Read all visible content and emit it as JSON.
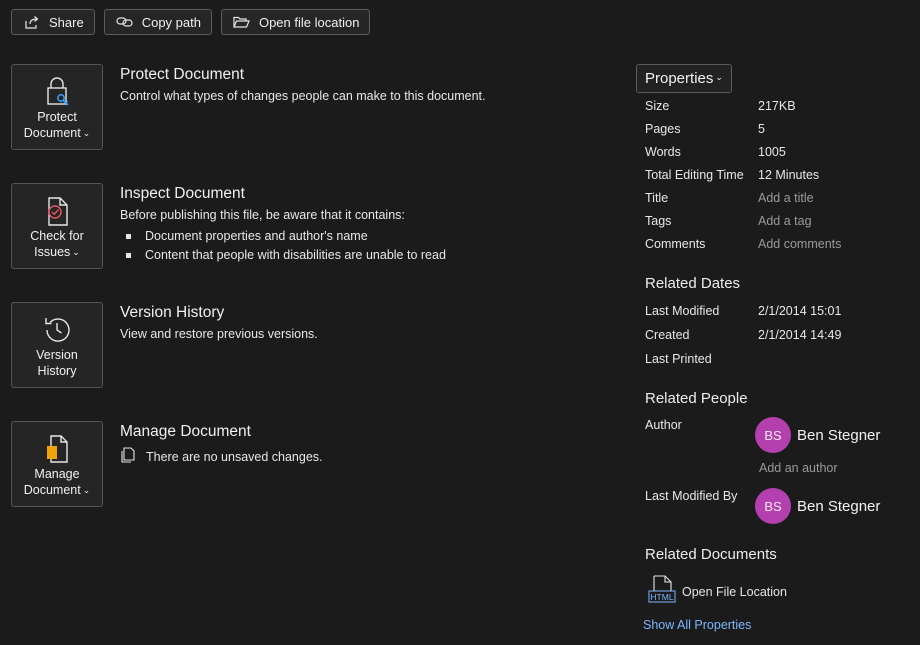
{
  "toolbar": {
    "share_label": "Share",
    "copy_path_label": "Copy path",
    "open_file_location_label": "Open file location"
  },
  "sections": {
    "protect": {
      "button_line1": "Protect",
      "button_line2": "Document",
      "title": "Protect Document",
      "description": "Control what types of changes people can make to this document."
    },
    "inspect": {
      "button_line1": "Check for",
      "button_line2": "Issues",
      "title": "Inspect Document",
      "description": "Before publishing this file, be aware that it contains:",
      "bullets": [
        "Document properties and author's name",
        "Content that people with disabilities are unable to read"
      ]
    },
    "version": {
      "button_line1": "Version",
      "button_line2": "History",
      "title": "Version History",
      "description": "View and restore previous versions."
    },
    "manage": {
      "button_line1": "Manage",
      "button_line2": "Document",
      "title": "Manage Document",
      "status": "There are no unsaved changes."
    }
  },
  "properties": {
    "header_label": "Properties",
    "rows": [
      {
        "key": "Size",
        "value": "217KB"
      },
      {
        "key": "Pages",
        "value": "5"
      },
      {
        "key": "Words",
        "value": "1005"
      },
      {
        "key": "Total Editing Time",
        "value": "12 Minutes"
      },
      {
        "key": "Title",
        "placeholder": "Add a title"
      },
      {
        "key": "Tags",
        "placeholder": "Add a tag"
      },
      {
        "key": "Comments",
        "placeholder": "Add comments"
      }
    ]
  },
  "related_dates": {
    "heading": "Related Dates",
    "rows": [
      {
        "key": "Last Modified",
        "value": "2/1/2014 15:01"
      },
      {
        "key": "Created",
        "value": "2/1/2014 14:49"
      },
      {
        "key": "Last Printed",
        "value": ""
      }
    ]
  },
  "related_people": {
    "heading": "Related People",
    "author_label": "Author",
    "author": {
      "initials": "BS",
      "name": "Ben Stegner"
    },
    "add_author_placeholder": "Add an author",
    "last_modified_by_label": "Last Modified By",
    "last_modified_by": {
      "initials": "BS",
      "name": "Ben Stegner"
    }
  },
  "related_documents": {
    "heading": "Related Documents",
    "open_file_location_label": "Open File Location",
    "html_icon_text": "HTML"
  },
  "show_all_properties_label": "Show All Properties",
  "colors": {
    "background": "#1b1b1b",
    "avatar": "#b43fae",
    "link": "#7eb6ff",
    "accent_icon": "#f0a30a"
  }
}
